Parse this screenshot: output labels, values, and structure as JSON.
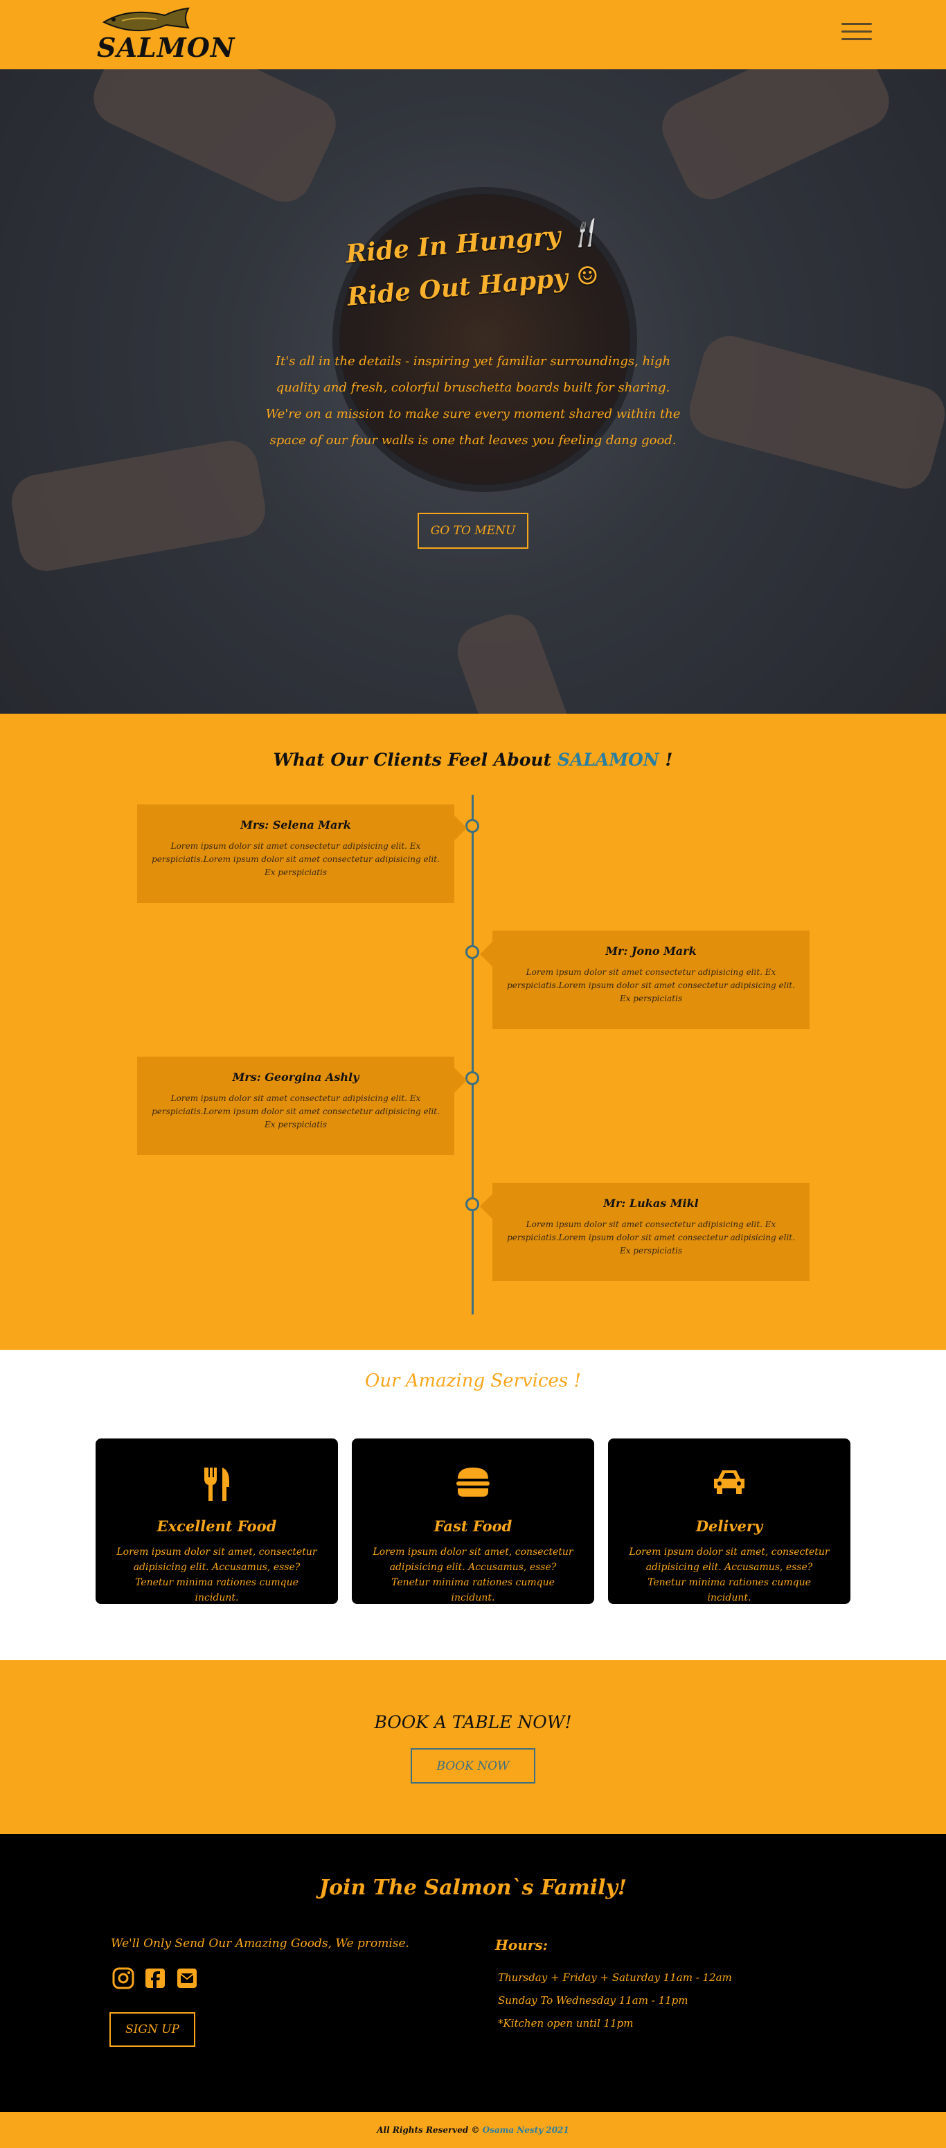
{
  "header": {
    "logo_text": "SALMON"
  },
  "hero": {
    "title_line1": "Ride In Hungry",
    "title_line2": "Ride Out Happy",
    "description": "It's all in the details - inspiring yet familiar surroundings, high quality and fresh, colorful bruschetta boards built for sharing. We're on a mission to make sure every moment shared within the space of our four walls is one that leaves you feeling dang good.",
    "button": "GO TO MENU"
  },
  "testimonials": {
    "title_prefix": "What Our Clients Feel About",
    "title_brand": "SALAMON",
    "title_suffix": "!",
    "items": [
      {
        "name": "Mrs: Selena Mark",
        "text": "Lorem ipsum dolor sit amet consectetur adipisicing elit. Ex perspiciatis.Lorem ipsum dolor sit amet consectetur adipisicing elit. Ex perspiciatis"
      },
      {
        "name": "Mr: Jono Mark",
        "text": "Lorem ipsum dolor sit amet consectetur adipisicing elit. Ex perspiciatis.Lorem ipsum dolor sit amet consectetur adipisicing elit. Ex perspiciatis"
      },
      {
        "name": "Mrs: Georgina Ashly",
        "text": "Lorem ipsum dolor sit amet consectetur adipisicing elit. Ex perspiciatis.Lorem ipsum dolor sit amet consectetur adipisicing elit. Ex perspiciatis"
      },
      {
        "name": "Mr: Lukas Mikl",
        "text": "Lorem ipsum dolor sit amet consectetur adipisicing elit. Ex perspiciatis.Lorem ipsum dolor sit amet consectetur adipisicing elit. Ex perspiciatis"
      }
    ]
  },
  "services": {
    "title": "Our Amazing Services !",
    "items": [
      {
        "icon": "utensils-icon",
        "title": "Excellent Food",
        "text": "Lorem ipsum dolor sit amet, consectetur adipisicing elit. Accusamus, esse? Tenetur minima rationes cumque incidunt."
      },
      {
        "icon": "burger-icon",
        "title": "Fast Food",
        "text": "Lorem ipsum dolor sit amet, consectetur adipisicing elit. Accusamus, esse? Tenetur minima rationes cumque incidunt."
      },
      {
        "icon": "car-icon",
        "title": "Delivery",
        "text": "Lorem ipsum dolor sit amet, consectetur adipisicing elit. Accusamus, esse? Tenetur minima rationes cumque incidunt."
      }
    ]
  },
  "book": {
    "title": "BOOK A TABLE NOW!",
    "button": "BOOK NOW"
  },
  "footer": {
    "title": "Join The Salmon`s Family!",
    "promise": "We'll Only Send Our Amazing Goods, We promise.",
    "signup": "SIGN UP",
    "hours_title": "Hours:",
    "hours": [
      "Thursday + Friday + Saturday 11am - 12am",
      "Sunday To Wednesday 11am - 11pm",
      "*Kitchen open until 11pm"
    ]
  },
  "bottom": {
    "rights": "All Rights Reserved ©",
    "author": "Osama Nesty 2021"
  },
  "colors": {
    "accent": "#f9a61b",
    "dark": "#000000",
    "brand_blue": "#2a7ea0",
    "timeline": "#3e6f80"
  }
}
